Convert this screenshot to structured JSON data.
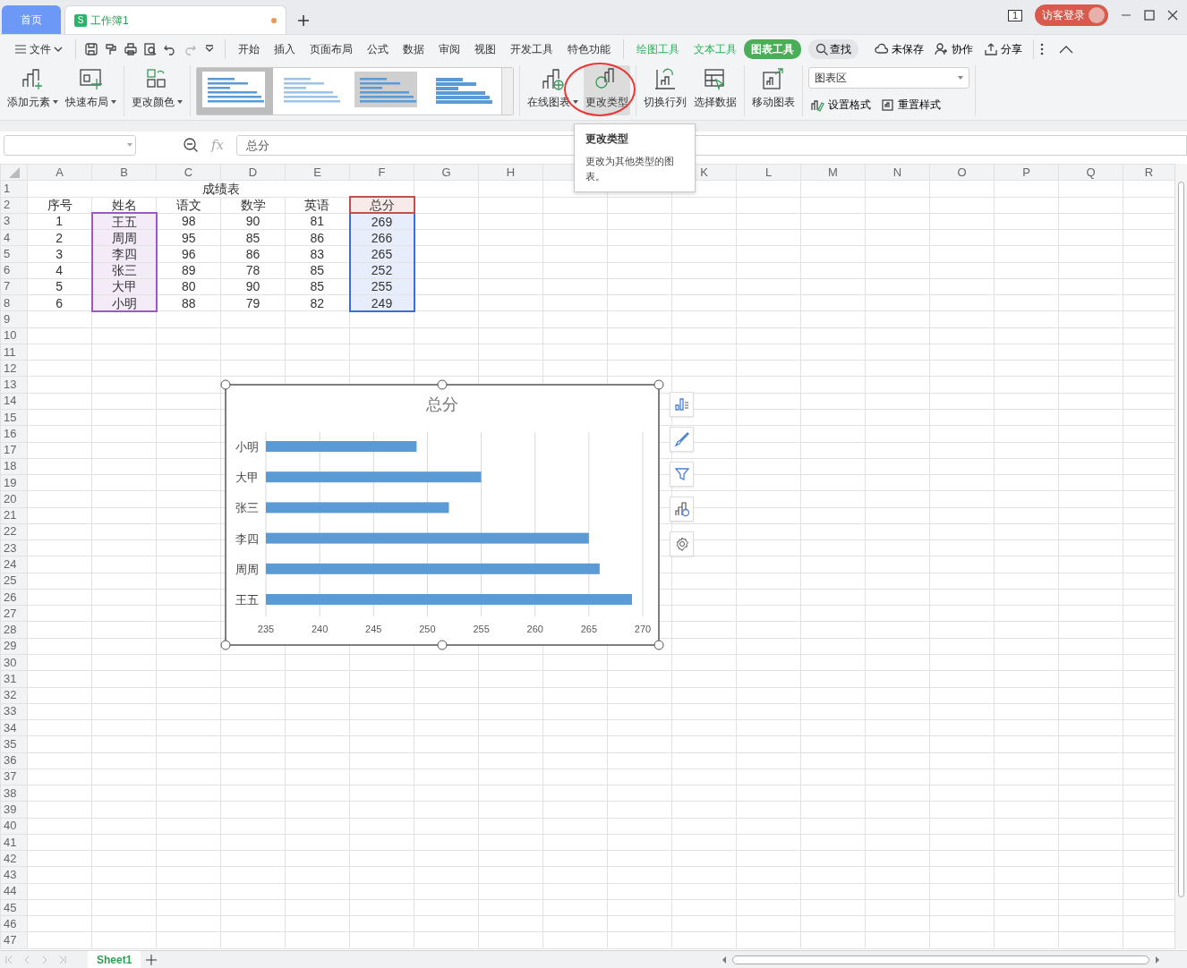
{
  "tabs": [
    {
      "label": "首页",
      "selected": false,
      "kind": "home"
    },
    {
      "label": "工作簿1",
      "selected": true,
      "kind": "doc",
      "badge": "S",
      "unsaved": true
    }
  ],
  "title_bar": {
    "page_count": "1",
    "login": "访客登录"
  },
  "menu": {
    "file": "文件",
    "quick_access": [
      {
        "disabled": false
      },
      {
        "disabled": false
      },
      {
        "disabled": false
      },
      {
        "disabled": false
      },
      {
        "disabled": false
      },
      {
        "disabled": true
      },
      {
        "disabled": false
      }
    ],
    "tabs": [
      {
        "label": "开始",
        "kind": "main",
        "selected": false
      },
      {
        "label": "插入",
        "kind": "main",
        "selected": false
      },
      {
        "label": "页面布局",
        "kind": "main",
        "selected": false
      },
      {
        "label": "公式",
        "kind": "main",
        "selected": false
      },
      {
        "label": "数据",
        "kind": "main",
        "selected": false
      },
      {
        "label": "审阅",
        "kind": "main",
        "selected": false
      },
      {
        "label": "视图",
        "kind": "main",
        "selected": false
      },
      {
        "label": "开发工具",
        "kind": "main",
        "selected": false
      },
      {
        "label": "特色功能",
        "kind": "main",
        "selected": false
      },
      {
        "label": "绘图工具",
        "kind": "tool",
        "selected": false
      },
      {
        "label": "文本工具",
        "kind": "tool",
        "selected": false
      },
      {
        "label": "图表工具",
        "kind": "tool",
        "selected": true
      }
    ],
    "search": "查找",
    "actions": [
      "未保存",
      "协作",
      "分享"
    ]
  },
  "ribbon": {
    "groups": [
      {
        "items": [
          {
            "kind": "big",
            "label": "添加元素",
            "dropdown": true
          },
          {
            "kind": "big",
            "label": "快速布局",
            "dropdown": true
          }
        ]
      },
      {
        "items": [
          {
            "kind": "big",
            "label": "更改颜色",
            "dropdown": true
          }
        ]
      },
      {
        "items": [
          {
            "kind": "gallery",
            "thumbs": [
              {
                "selected": true
              },
              {
                "selected": false
              },
              {
                "selected": false
              },
              {
                "selected": false
              }
            ]
          }
        ]
      },
      {
        "items": [
          {
            "kind": "big",
            "label": "在线图表",
            "dropdown": true
          },
          {
            "kind": "big",
            "label": "更改类型",
            "dropdown": false,
            "hovered": true,
            "circled": true
          }
        ]
      },
      {
        "items": [
          {
            "kind": "big",
            "label": "切换行列",
            "dropdown": false
          },
          {
            "kind": "big",
            "label": "选择数据",
            "dropdown": false
          }
        ]
      },
      {
        "items": [
          {
            "kind": "big",
            "label": "移动图表",
            "dropdown": false
          }
        ]
      },
      {
        "items": [
          {
            "kind": "select",
            "value": "图表区"
          },
          {
            "kind": "small",
            "label": "设置格式"
          },
          {
            "kind": "small",
            "label": "重置样式"
          }
        ]
      }
    ]
  },
  "tooltip": {
    "title": "更改类型",
    "text": "更改为其他类型的图表。"
  },
  "formula_bar": {
    "fx": "fx",
    "formula": "总分"
  },
  "sheet": {
    "columns": [
      "A",
      "B",
      "C",
      "D",
      "E",
      "F",
      "G",
      "H",
      null,
      null,
      "K",
      "L",
      "M",
      "N",
      "O",
      "P",
      "Q",
      "R"
    ],
    "row_headers": [
      "1",
      "2",
      "3",
      "4",
      "5",
      "6",
      "7",
      "8",
      "9",
      "10",
      "11",
      "12",
      "13",
      "14",
      "15",
      "16",
      "17",
      "18",
      "19",
      "20",
      "21",
      "22",
      "23",
      "24",
      "25",
      "26",
      "27",
      "28",
      "29",
      "30",
      "31",
      "32",
      "33",
      "34",
      "35",
      "36",
      "37",
      "38",
      "39",
      "40",
      "41",
      "42",
      "43",
      "44",
      "45",
      "46",
      "47"
    ],
    "title": "成绩表",
    "rows": [
      [
        {
          "text": "序号"
        },
        {
          "text": "姓名"
        },
        {
          "text": "语文"
        },
        {
          "text": "数学"
        },
        {
          "text": "英语"
        },
        {
          "text": "总分",
          "color": "#c0504d"
        }
      ],
      [
        {
          "text": "1"
        },
        {
          "text": "王五",
          "color": "#9b59c6"
        },
        {
          "text": "98"
        },
        {
          "text": "90"
        },
        {
          "text": "81"
        },
        {
          "text": "269",
          "color": "#3c6fd6"
        }
      ],
      [
        {
          "text": "2"
        },
        {
          "text": "周周",
          "color": "#9b59c6"
        },
        {
          "text": "95"
        },
        {
          "text": "85"
        },
        {
          "text": "86"
        },
        {
          "text": "266",
          "color": "#3c6fd6"
        }
      ],
      [
        {
          "text": "3"
        },
        {
          "text": "李四",
          "color": "#9b59c6"
        },
        {
          "text": "96"
        },
        {
          "text": "86"
        },
        {
          "text": "83"
        },
        {
          "text": "265",
          "color": "#3c6fd6"
        }
      ],
      [
        {
          "text": "4"
        },
        {
          "text": "张三",
          "color": "#9b59c6"
        },
        {
          "text": "89"
        },
        {
          "text": "78"
        },
        {
          "text": "85"
        },
        {
          "text": "252",
          "color": "#3c6fd6"
        }
      ],
      [
        {
          "text": "5"
        },
        {
          "text": "大甲",
          "color": "#9b59c6"
        },
        {
          "text": "80"
        },
        {
          "text": "90"
        },
        {
          "text": "85"
        },
        {
          "text": "255",
          "color": "#3c6fd6"
        }
      ],
      [
        {
          "text": "6"
        },
        {
          "text": "小明",
          "color": "#9b59c6"
        },
        {
          "text": "88"
        },
        {
          "text": "79"
        },
        {
          "text": "82"
        },
        {
          "text": "249",
          "color": "#3c6fd6"
        }
      ]
    ]
  },
  "chart": {
    "selected": true,
    "chart_data": {
      "type": "bar",
      "orientation": "horizontal",
      "title": "总分",
      "categories": [
        "小明",
        "大甲",
        "张三",
        "李四",
        "周周",
        "王五"
      ],
      "series": [
        {
          "color": "#5b9bd5",
          "values": [
            249,
            255,
            252,
            265,
            266,
            269
          ]
        }
      ],
      "grid": true,
      "xlim": [
        235,
        270
      ],
      "xticks": [
        235,
        240,
        245,
        250,
        255,
        260,
        265,
        270
      ]
    }
  },
  "sheet_tabs": [
    {
      "label": "Sheet1",
      "selected": true
    }
  ]
}
